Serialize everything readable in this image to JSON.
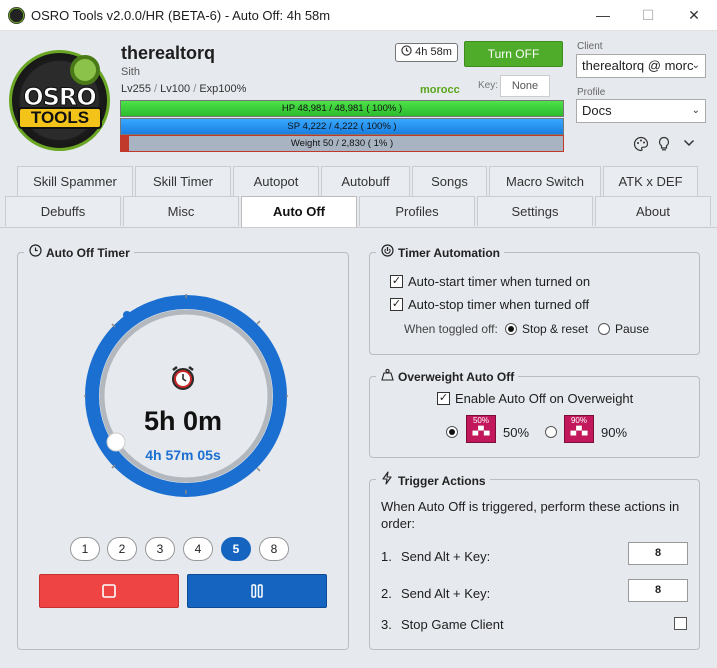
{
  "window": {
    "title": "OSRO Tools v2.0.0/HR (BETA-6) - Auto Off: 4h 58m",
    "minimize": "—",
    "maximize": "☐",
    "close": "✕"
  },
  "logo": {
    "line1": "OSRO",
    "line2": "TOOLS"
  },
  "player": {
    "name": "therealtorq",
    "class": "Sith",
    "lv": "Lv255",
    "sep1": "/",
    "lv2": "Lv100",
    "sep2": "/",
    "exp_label": "Exp",
    "exp": "100%",
    "server": "morocc"
  },
  "timer_chip": {
    "icon": "clock-icon",
    "text": "4h 58m"
  },
  "turn_off": "Turn OFF",
  "key": {
    "label": "Key:",
    "value": "None"
  },
  "bars": {
    "hp": {
      "text": "HP  48,981  /  48,981  ( 100% )",
      "fraction": 1.0,
      "color": "#2dbb2d"
    },
    "sp": {
      "text": "SP  4,222  /  4,222  ( 100% )",
      "fraction": 1.0,
      "color": "#1a7fe0"
    },
    "weight": {
      "text": "Weight  50  /  2,830  ( 1% )",
      "fraction": 0.018,
      "color": "#c0392b"
    }
  },
  "client": {
    "label": "Client",
    "value": "therealtorq @ morc"
  },
  "profile": {
    "label": "Profile",
    "value": "Docs"
  },
  "header_icons": [
    "palette-icon",
    "lightbulb-icon",
    "chevron-down-icon"
  ],
  "tabs_row1": [
    "Skill Spammer",
    "Skill Timer",
    "Autopot",
    "Autobuff",
    "Songs",
    "Macro Switch",
    "ATK x DEF"
  ],
  "tabs_row2": [
    "Debuffs",
    "Misc",
    "Auto Off",
    "Profiles",
    "Settings",
    "About"
  ],
  "active_tab": "Auto Off",
  "auto_off_timer": {
    "title": "Auto Off Timer",
    "time": "5h 0m",
    "remaining": "4h 57m 05s",
    "presets": [
      "1",
      "2",
      "3",
      "4",
      "5",
      "8"
    ],
    "selected_preset": "5",
    "stop_color": "#ef4444",
    "pause_color": "#1565c0",
    "ring_color": "#1a6fd1"
  },
  "timer_automation": {
    "title": "Timer Automation",
    "auto_start": "Auto-start timer when turned on",
    "auto_stop": "Auto-stop timer when turned off",
    "when_toggled": "When toggled off:",
    "opt_stop_reset": "Stop & reset",
    "opt_pause": "Pause"
  },
  "overweight": {
    "title": "Overweight Auto Off",
    "enable": "Enable Auto Off on Overweight",
    "opt50": "50%",
    "opt90": "90%",
    "icon50": "50%",
    "icon90": "90%"
  },
  "trigger": {
    "title": "Trigger Actions",
    "desc": "When Auto Off is triggered, perform these actions in order:",
    "actions": [
      {
        "num": "1.",
        "label": "Send Alt + Key:",
        "value": "8"
      },
      {
        "num": "2.",
        "label": "Send Alt + Key:",
        "value": "8"
      },
      {
        "num": "3.",
        "label": "Stop Game Client"
      }
    ]
  }
}
